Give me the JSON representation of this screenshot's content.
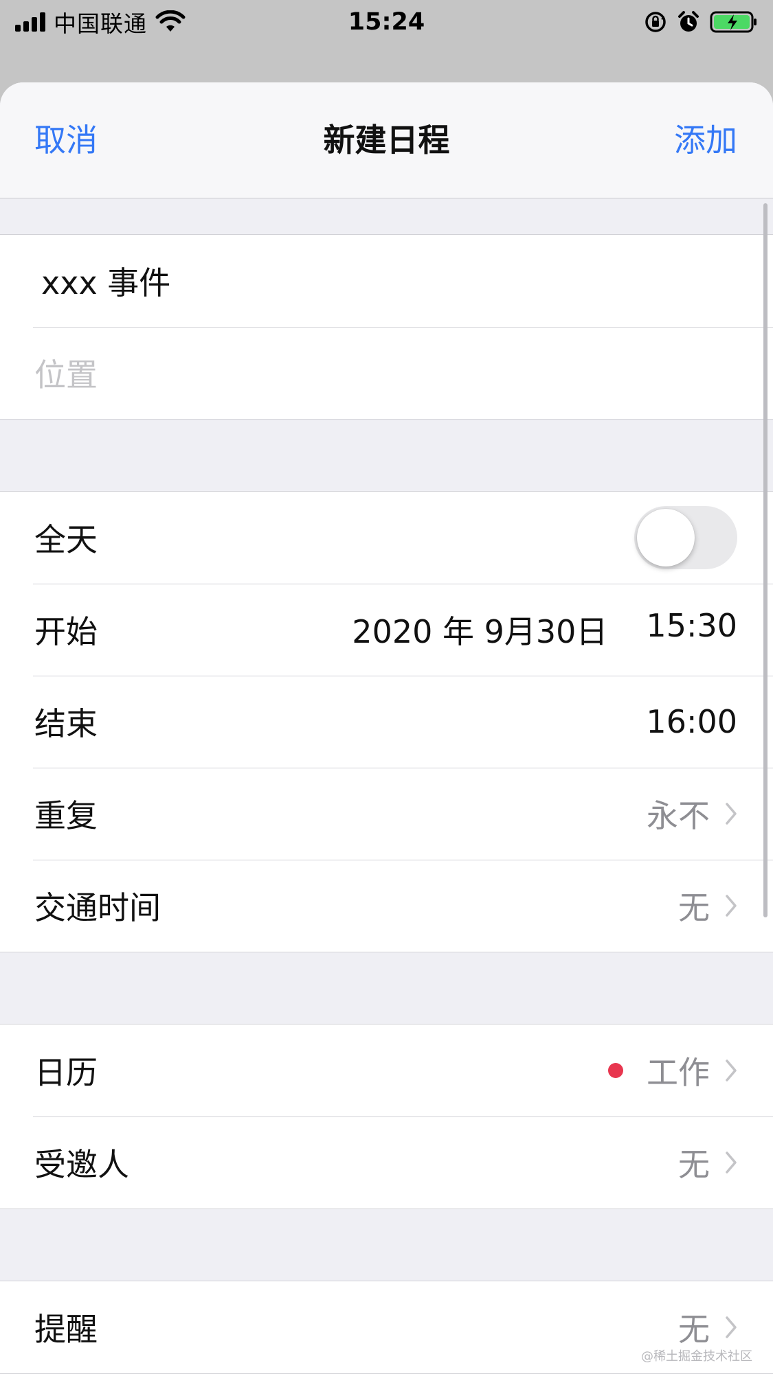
{
  "status_bar": {
    "carrier": "中国联通",
    "time": "15:24"
  },
  "navbar": {
    "cancel": "取消",
    "title": "新建日程",
    "add": "添加"
  },
  "fields": {
    "title_value": "xxx 事件",
    "location_placeholder": "位置"
  },
  "time_section": {
    "all_day_label": "全天",
    "all_day_enabled": false,
    "start_label": "开始",
    "start_date": "2020 年 9月30日",
    "start_time": "15:30",
    "end_label": "结束",
    "end_time": "16:00",
    "repeat_label": "重复",
    "repeat_value": "永不",
    "travel_label": "交通时间",
    "travel_value": "无"
  },
  "calendar_section": {
    "calendar_label": "日历",
    "calendar_value": "工作",
    "calendar_color": "#e8364f",
    "invitees_label": "受邀人",
    "invitees_value": "无"
  },
  "alert_section": {
    "alert_label": "提醒",
    "alert_value": "无"
  },
  "watermark": "@稀土掘金技术社区",
  "colors": {
    "accent": "#3478f6",
    "secondary_text": "#8e8e93"
  }
}
